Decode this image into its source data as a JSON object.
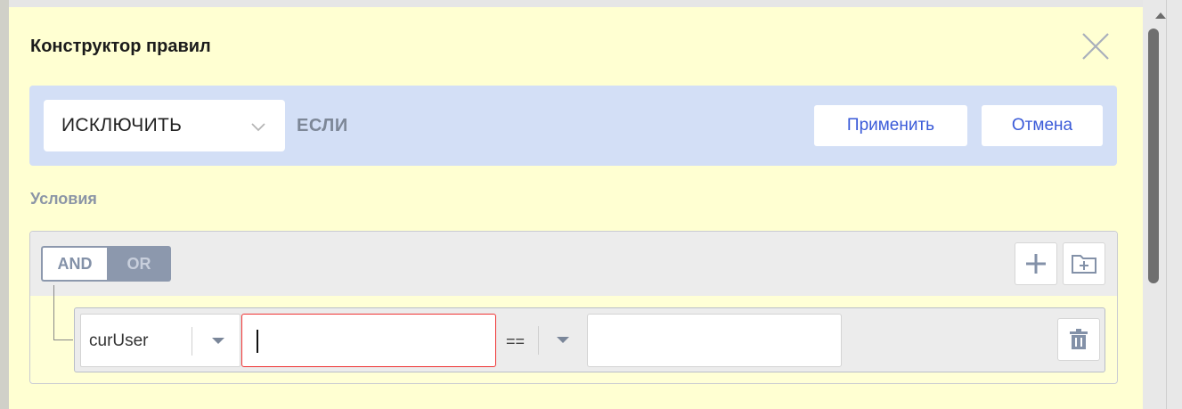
{
  "modal": {
    "title": "Конструктор правил",
    "close_icon": "close-icon"
  },
  "rule_bar": {
    "action_value": "ИСКЛЮЧИТЬ",
    "if_label": "ЕСЛИ",
    "apply_label": "Применить",
    "cancel_label": "Отмена"
  },
  "conditions": {
    "label": "Условия",
    "combinator": {
      "and_label": "AND",
      "or_label": "OR",
      "selected": "AND"
    },
    "add_rule_icon": "plus-icon",
    "add_group_icon": "folder-plus-icon",
    "rules": [
      {
        "field": "curUser",
        "text_value": "",
        "operator": "==",
        "value": "",
        "delete_icon": "trash-icon"
      }
    ]
  },
  "colors": {
    "modal_bg": "#ffffd2",
    "rule_bar_bg": "#d3dff6",
    "accent_text": "#3a5ad8",
    "invalid_border": "#e33333",
    "toggle_active": "#8c98ad"
  }
}
